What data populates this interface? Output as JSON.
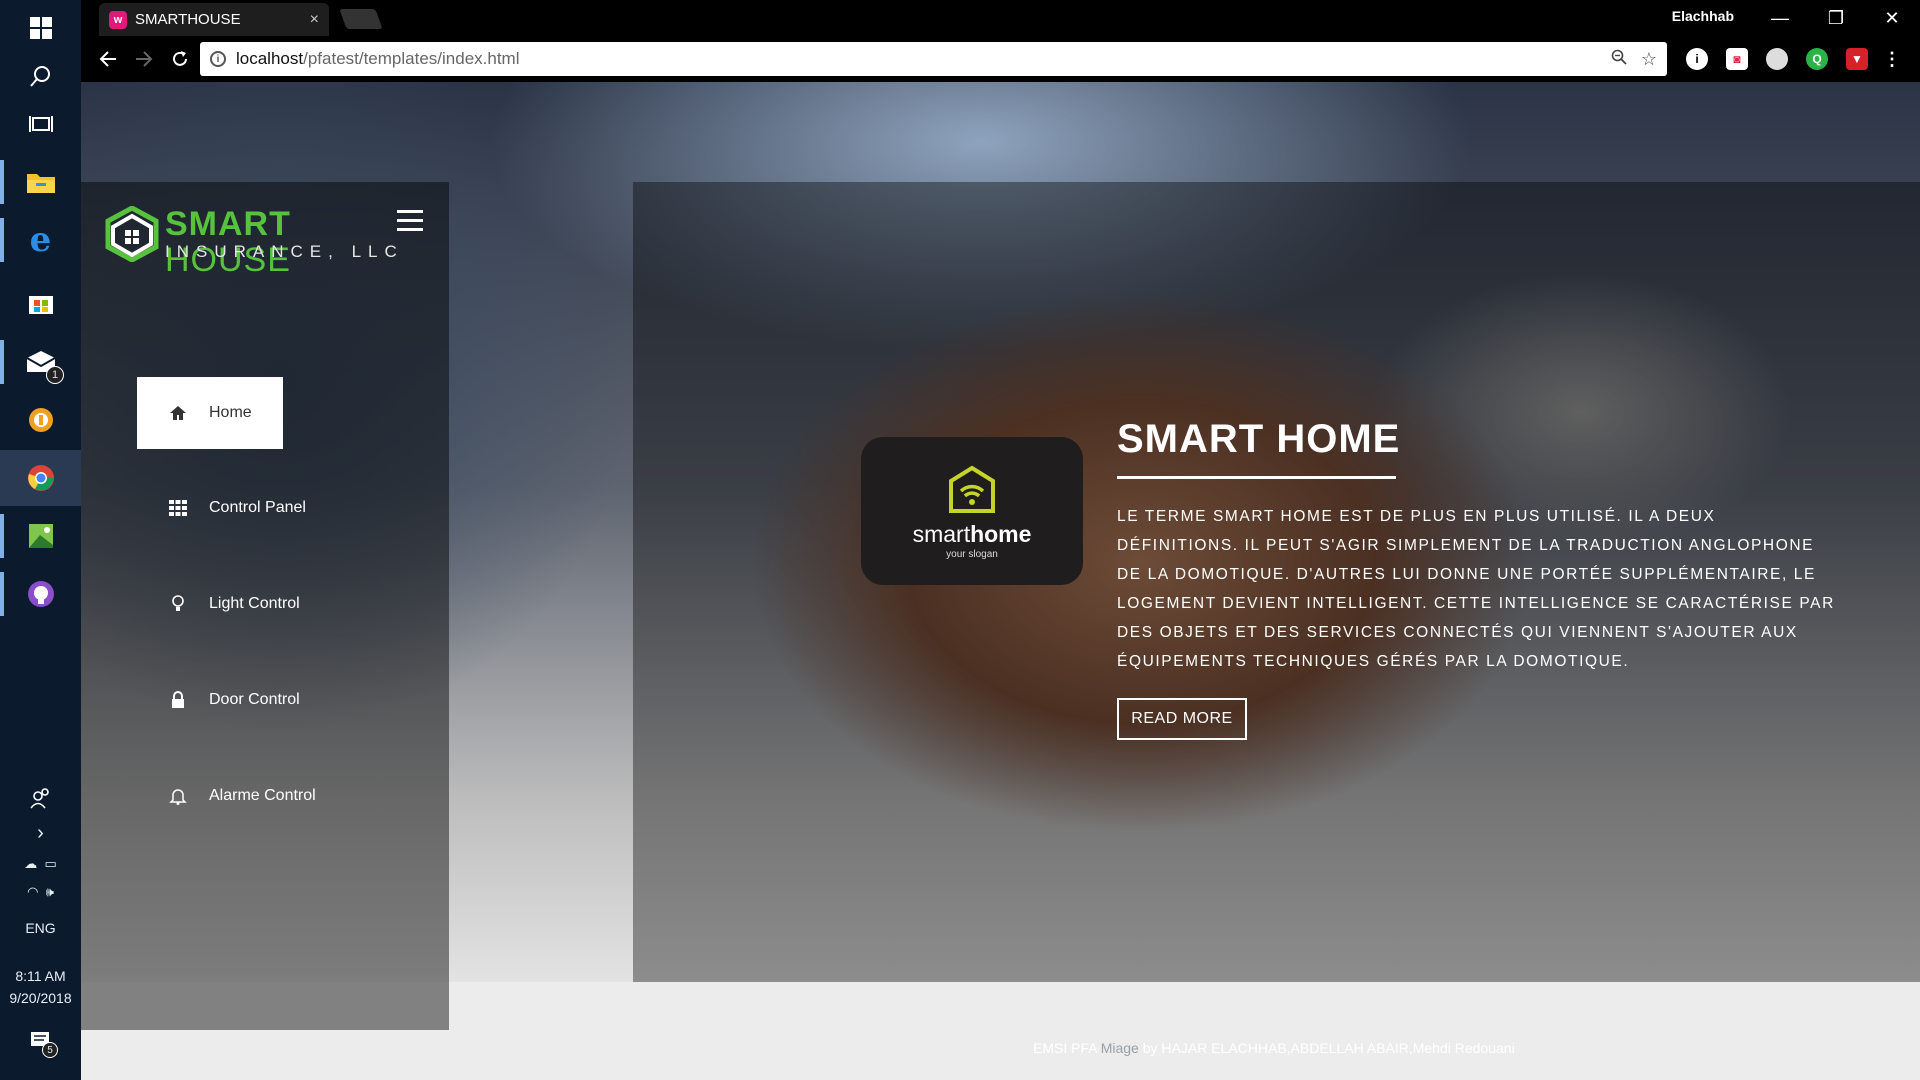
{
  "taskbar": {
    "tray_lang": "ENG",
    "time": "8:11 AM",
    "date": "9/20/2018",
    "mail_badge": "1",
    "notif_badge": "5"
  },
  "browser": {
    "tab_title": "SMARTHOUSE",
    "tab_close": "×",
    "profile_name": "Elachhab",
    "url_host": "localhost",
    "url_path": "/pfatest/templates/index.html",
    "min_label": "—",
    "max_label": "❐",
    "close_label": "✕"
  },
  "site": {
    "logo_smart": "SMART",
    "logo_house": "HOUSE",
    "logo_insurance": "INSURANCE, LLC",
    "nav": [
      {
        "label": "Home",
        "icon": "home-icon"
      },
      {
        "label": "Control Panel",
        "icon": "grid-icon"
      },
      {
        "label": "Light Control",
        "icon": "lightbulb-icon"
      },
      {
        "label": "Door Control",
        "icon": "lock-icon"
      },
      {
        "label": "Alarme Control",
        "icon": "bell-icon"
      }
    ],
    "card_brand_a": "smart",
    "card_brand_b": "home",
    "card_slogan": "your slogan",
    "hero_title": "SMART HOME",
    "hero_text": "Le terme Smart Home est de plus en plus utilisé. Il a deux définitions. Il peut s'agir simplement de la traduction anglophone de la domotique. D'autres lui donne une portée supplémentaire, le logement devient intelligent. Cette intelligence se caractérise par des objets et des services connectés qui viennent s'ajouter aux équipements techniques gérés par la domotique.",
    "read_more": "READ MORE",
    "footer_a": "EMSI PFA",
    "footer_b": "Miage",
    "footer_c": "by HAJAR ELACHHAB,ABDELLAH ABAIR,Mehdi Redouani"
  },
  "colors": {
    "accent_green": "#57c23c",
    "taskbar": "#0c1a2e"
  }
}
